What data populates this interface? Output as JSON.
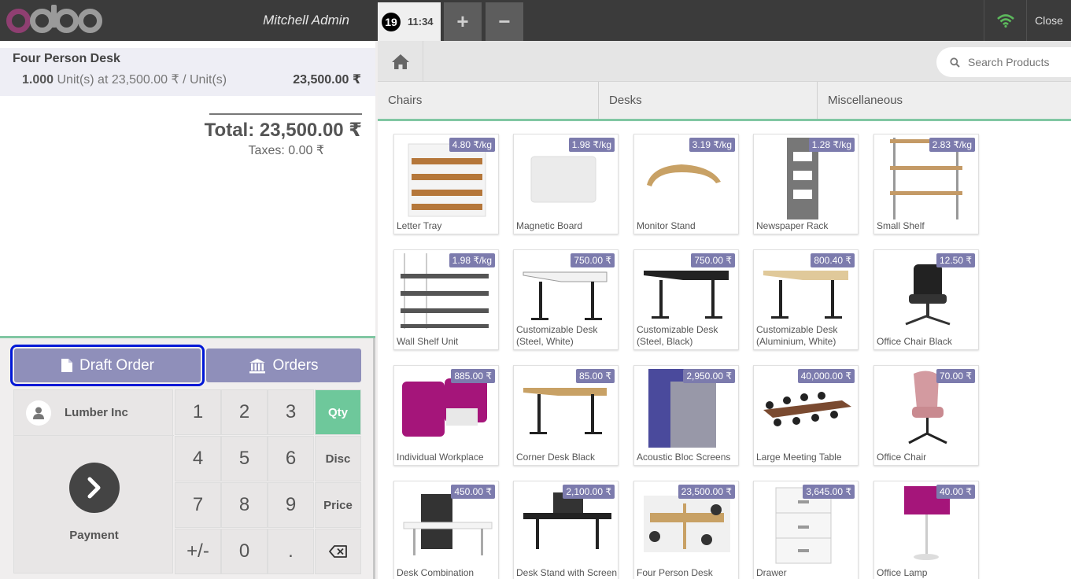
{
  "header": {
    "user_name": "Mitchell Admin",
    "order_number": "19",
    "order_time": "11:34",
    "add_label": "+",
    "remove_label": "−",
    "close_label": "Close",
    "wifi_color": "#5cb85c"
  },
  "order": {
    "line": {
      "name": "Four Person Desk",
      "quantity": "1.000",
      "unit_info": "Unit(s) at 23,500.00 ₹ / Unit(s)",
      "price": "23,500.00 ₹"
    },
    "total": "Total: 23,500.00 ₹",
    "taxes": "Taxes: 0.00 ₹"
  },
  "controls": {
    "draft_label": "Draft Order",
    "orders_label": "Orders"
  },
  "actionpad": {
    "customer": "Lumber Inc",
    "payment_label": "Payment"
  },
  "numpad": {
    "keys": [
      "1",
      "2",
      "3",
      "4",
      "5",
      "6",
      "7",
      "8",
      "9",
      "+/-",
      "0",
      "."
    ],
    "modes": [
      "Qty",
      "Disc",
      "Price"
    ],
    "active_mode": "Qty"
  },
  "search": {
    "placeholder": "Search Products"
  },
  "categories": [
    "Chairs",
    "Desks",
    "Miscellaneous"
  ],
  "products": [
    {
      "name": "Letter Tray",
      "price": "4.80 ₹/kg"
    },
    {
      "name": "Magnetic Board",
      "price": "1.98 ₹/kg"
    },
    {
      "name": "Monitor Stand",
      "price": "3.19 ₹/kg"
    },
    {
      "name": "Newspaper Rack",
      "price": "1.28 ₹/kg"
    },
    {
      "name": "Small Shelf",
      "price": "2.83 ₹/kg"
    },
    {
      "name": "Wall Shelf Unit",
      "price": "1.98 ₹/kg"
    },
    {
      "name": "Customizable Desk (Steel, White)",
      "price": "750.00 ₹"
    },
    {
      "name": "Customizable Desk (Steel, Black)",
      "price": "750.00 ₹"
    },
    {
      "name": "Customizable Desk (Aluminium, White)",
      "price": "800.40 ₹"
    },
    {
      "name": "Office Chair Black",
      "price": "12.50 ₹"
    },
    {
      "name": "Individual Workplace",
      "price": "885.00 ₹"
    },
    {
      "name": "Corner Desk Black",
      "price": "85.00 ₹"
    },
    {
      "name": "Acoustic Bloc Screens",
      "price": "2,950.00 ₹"
    },
    {
      "name": "Large Meeting Table",
      "price": "40,000.00 ₹"
    },
    {
      "name": "Office Chair",
      "price": "70.00 ₹"
    },
    {
      "name": "Desk Combination",
      "price": "450.00 ₹"
    },
    {
      "name": "Desk Stand with Screen",
      "price": "2,100.00 ₹"
    },
    {
      "name": "Four Person Desk",
      "price": "23,500.00 ₹"
    },
    {
      "name": "Drawer",
      "price": "3,645.00 ₹"
    },
    {
      "name": "Office Lamp",
      "price": "40.00 ₹"
    }
  ]
}
